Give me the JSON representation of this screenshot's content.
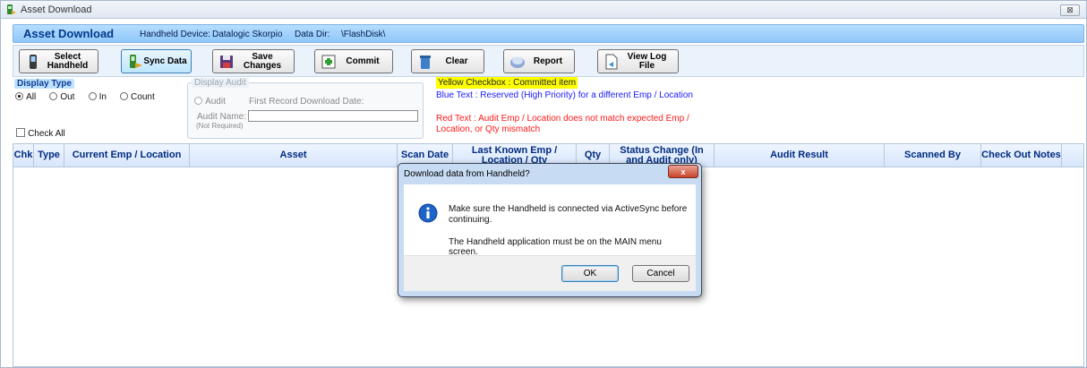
{
  "window": {
    "title": "Asset Download",
    "close_glyph": "⊠"
  },
  "header": {
    "app_title": "Asset Download",
    "device_label": "Handheld Device:",
    "device_value": "Datalogic Skorpio",
    "dir_label": "Data Dir:",
    "dir_value": "\\FlashDisk\\"
  },
  "toolbar": {
    "select_handheld": [
      "Select",
      "Handheld"
    ],
    "sync_data": "Sync Data",
    "save_changes": [
      "Save",
      "Changes"
    ],
    "commit": "Commit",
    "clear": "Clear",
    "report": "Report",
    "view_log": "View Log File"
  },
  "display_type": {
    "label": "Display Type",
    "options": [
      "All",
      "Out",
      "In",
      "Count"
    ],
    "selected": "All",
    "check_all": "Check All"
  },
  "display_audit": {
    "label": "Display Audit",
    "audit_option": "Audit",
    "first_record_label": "First Record Download Date:",
    "audit_name_label": "Audit Name:",
    "audit_name_note": "(Not Required)",
    "audit_name_value": ""
  },
  "legend": {
    "yellow": "Yellow Checkbox :  Committed item",
    "blue": "Blue Text :  Reserved (High Priority) for a different Emp / Location",
    "red": "Red Text :  Audit Emp / Location does not match expected Emp / Location, or Qty mismatch",
    "colors": {
      "yellow": "#ffff00",
      "blue": "#1a1aff",
      "red": "#ff1a1a"
    }
  },
  "table": {
    "columns": [
      "Chk",
      "Type",
      "Current Emp / Location",
      "Asset",
      "Scan Date",
      "Last Known Emp / Location / Qty",
      "Qty",
      "Status Change (In and Audit only)",
      "Audit Result",
      "Scanned By",
      "Check Out Notes"
    ],
    "rows": []
  },
  "dialog": {
    "title": "Download data from Handheld?",
    "close_glyph": "x",
    "message_1": "Make sure the Handheld is connected via ActiveSync before continuing.",
    "message_2": "The Handheld application must be on the MAIN menu screen.",
    "ok_label": "OK",
    "cancel_label": "Cancel"
  }
}
